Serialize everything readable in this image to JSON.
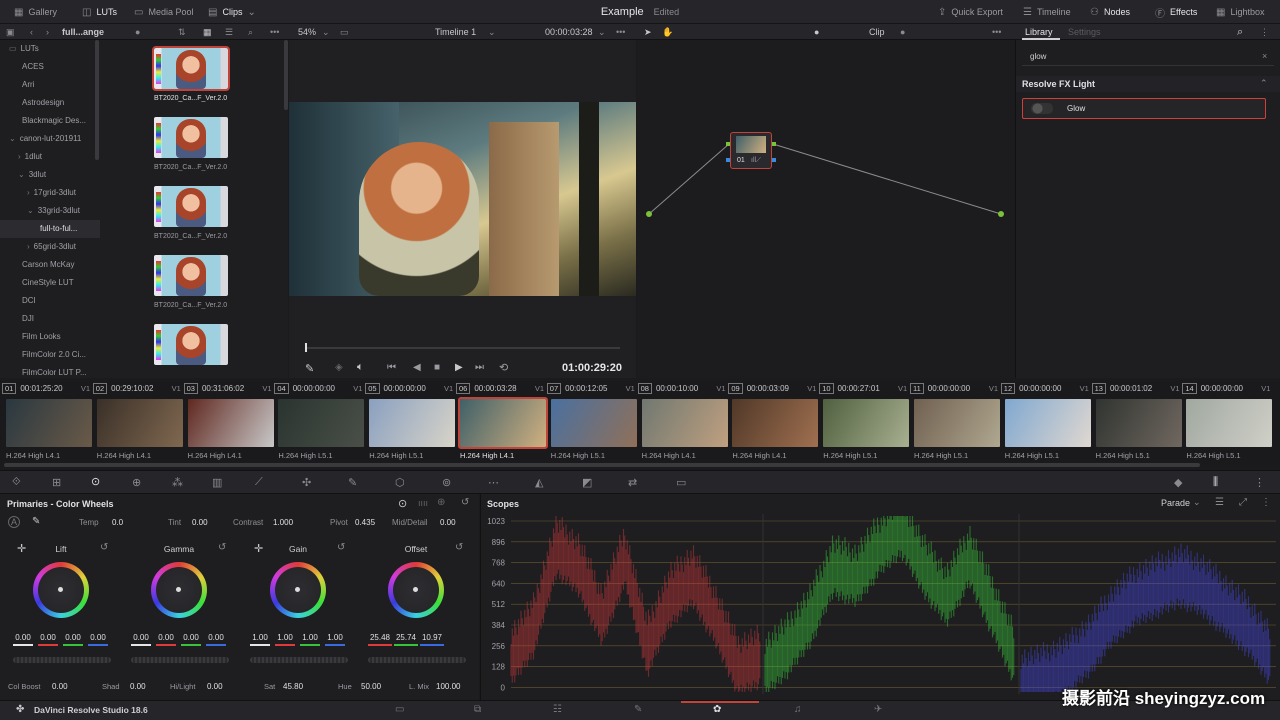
{
  "topbar": {
    "left": [
      {
        "icon": "gallery-icon",
        "label": "Gallery"
      },
      {
        "icon": "luts-icon",
        "label": "LUTs"
      },
      {
        "icon": "media-pool-icon",
        "label": "Media Pool"
      },
      {
        "icon": "clips-icon",
        "label": "Clips"
      }
    ],
    "project_name": "Example",
    "project_status": "Edited",
    "right": [
      {
        "icon": "quick-export-icon",
        "label": "Quick Export"
      },
      {
        "icon": "timeline-icon",
        "label": "Timeline"
      },
      {
        "icon": "nodes-icon",
        "label": "Nodes"
      },
      {
        "icon": "effects-icon",
        "label": "Effects"
      },
      {
        "icon": "lightbox-icon",
        "label": "Lightbox"
      }
    ]
  },
  "subbar": {
    "lut_path": "full...ange",
    "zoom": "54%",
    "timeline_name": "Timeline 1",
    "timecode": "00:00:03:28",
    "node_mode": "Clip",
    "tab_library": "Library",
    "tab_settings": "Settings"
  },
  "lut_tree": [
    {
      "label": "LUTs",
      "indent": 1
    },
    {
      "label": "ACES",
      "indent": 2
    },
    {
      "label": "Arri",
      "indent": 2
    },
    {
      "label": "Astrodesign",
      "indent": 2
    },
    {
      "label": "Blackmagic Des...",
      "indent": 2
    },
    {
      "label": "canon-lut-201911",
      "indent": 1
    },
    {
      "label": "1dlut",
      "indent": 2
    },
    {
      "label": "3dlut",
      "indent": 2
    },
    {
      "label": "17grid-3dlut",
      "indent": 3
    },
    {
      "label": "33grid-3dlut",
      "indent": 3
    },
    {
      "label": "full-to-ful...",
      "indent": 4
    },
    {
      "label": "65grid-3dlut",
      "indent": 3
    },
    {
      "label": "Carson McKay",
      "indent": 2
    },
    {
      "label": "CineStyle LUT",
      "indent": 2
    },
    {
      "label": "DCI",
      "indent": 2
    },
    {
      "label": "DJI",
      "indent": 2
    },
    {
      "label": "Film Looks",
      "indent": 2
    },
    {
      "label": "FilmColor 2.0 Ci...",
      "indent": 2
    },
    {
      "label": "FilmColor LUT P...",
      "indent": 2
    }
  ],
  "lut_thumbs": [
    "BT2020_Ca...F_Ver.2.0",
    "BT2020_Ca...F_Ver.2.0",
    "BT2020_Ca...F_Ver.2.0",
    "BT2020_Ca...F_Ver.2.0"
  ],
  "viewer": {
    "timecode": "01:00:29:20"
  },
  "node": {
    "label": "01"
  },
  "library": {
    "search_value": "glow",
    "section": "Resolve FX Light",
    "item": "Glow"
  },
  "clips": [
    {
      "num": "01",
      "tc": "00:01:25:20",
      "track": "V1",
      "codec": "H.264 High L4.1",
      "c1": "#2a3840",
      "c2": "#6a5a48"
    },
    {
      "num": "02",
      "tc": "00:29:10:02",
      "track": "V1",
      "codec": "H.264 High L4.1",
      "c1": "#3a3028",
      "c2": "#806850"
    },
    {
      "num": "03",
      "tc": "00:31:06:02",
      "track": "V1",
      "codec": "H.264 High L4.1",
      "c1": "#602820",
      "c2": "#c8c8c8"
    },
    {
      "num": "04",
      "tc": "00:00:00:00",
      "track": "V1",
      "codec": "H.264 High L5.1",
      "c1": "#2a3430",
      "c2": "#4a5048"
    },
    {
      "num": "05",
      "tc": "00:00:00:00",
      "track": "V1",
      "codec": "H.264 High L5.1",
      "c1": "#8aa0c0",
      "c2": "#d8d4c8"
    },
    {
      "num": "06",
      "tc": "00:00:03:28",
      "track": "V1",
      "codec": "H.264 High L4.1",
      "c1": "#406068",
      "c2": "#d0b080"
    },
    {
      "num": "07",
      "tc": "00:00:12:05",
      "track": "V1",
      "codec": "H.264 High L5.1",
      "c1": "#4a70a0",
      "c2": "#907058"
    },
    {
      "num": "08",
      "tc": "00:00:10:00",
      "track": "V1",
      "codec": "H.264 High L4.1",
      "c1": "#707870",
      "c2": "#c0a080"
    },
    {
      "num": "09",
      "tc": "00:00:03:09",
      "track": "V1",
      "codec": "H.264 High L4.1",
      "c1": "#503828",
      "c2": "#a07050"
    },
    {
      "num": "10",
      "tc": "00:00:27:01",
      "track": "V1",
      "codec": "H.264 High L5.1",
      "c1": "#506040",
      "c2": "#a8b090"
    },
    {
      "num": "11",
      "tc": "00:00:00:00",
      "track": "V1",
      "codec": "H.264 High L5.1",
      "c1": "#706050",
      "c2": "#b0a890"
    },
    {
      "num": "12",
      "tc": "00:00:00:00",
      "track": "V1",
      "codec": "H.264 High L5.1",
      "c1": "#80a8d0",
      "c2": "#e0d8d0"
    },
    {
      "num": "13",
      "tc": "00:00:01:02",
      "track": "V1",
      "codec": "H.264 High L5.1",
      "c1": "#303430",
      "c2": "#706860"
    },
    {
      "num": "14",
      "tc": "00:00:00:00",
      "track": "V1",
      "codec": "H.264 High L5.1",
      "c1": "#a0a8a0",
      "c2": "#d0d0c8"
    }
  ],
  "primaries": {
    "title": "Primaries - Color Wheels",
    "temp_label": "Temp",
    "temp": "0.0",
    "tint_label": "Tint",
    "tint": "0.00",
    "contrast_label": "Contrast",
    "contrast": "1.000",
    "pivot_label": "Pivot",
    "pivot": "0.435",
    "middetail_label": "Mid/Detail",
    "middetail": "0.00",
    "wheels": [
      {
        "name": "Lift",
        "vals": [
          "0.00",
          "0.00",
          "0.00",
          "0.00"
        ]
      },
      {
        "name": "Gamma",
        "vals": [
          "0.00",
          "0.00",
          "0.00",
          "0.00"
        ]
      },
      {
        "name": "Gain",
        "vals": [
          "1.00",
          "1.00",
          "1.00",
          "1.00"
        ]
      },
      {
        "name": "Offset",
        "vals": [
          "25.48",
          "25.74",
          "10.97"
        ]
      }
    ],
    "colboost_label": "Col Boost",
    "colboost": "0.00",
    "shad_label": "Shad",
    "shad": "0.00",
    "hilight_label": "Hi/Light",
    "hilight": "0.00",
    "sat_label": "Sat",
    "sat": "45.80",
    "hue_label": "Hue",
    "hue": "50.00",
    "lmix_label": "L. Mix",
    "lmix": "100.00"
  },
  "scopes": {
    "title": "Scopes",
    "mode": "Parade",
    "ticks": [
      "1023",
      "896",
      "768",
      "640",
      "512",
      "384",
      "256",
      "128",
      "0"
    ]
  },
  "bottom": {
    "app": "DaVinci Resolve Studio 18.6"
  },
  "watermark": "摄影前沿 sheyingzyz.com",
  "colors": {
    "accent_red": "#c0443a",
    "panel": "#1e1e21",
    "bar": "#26262a"
  }
}
